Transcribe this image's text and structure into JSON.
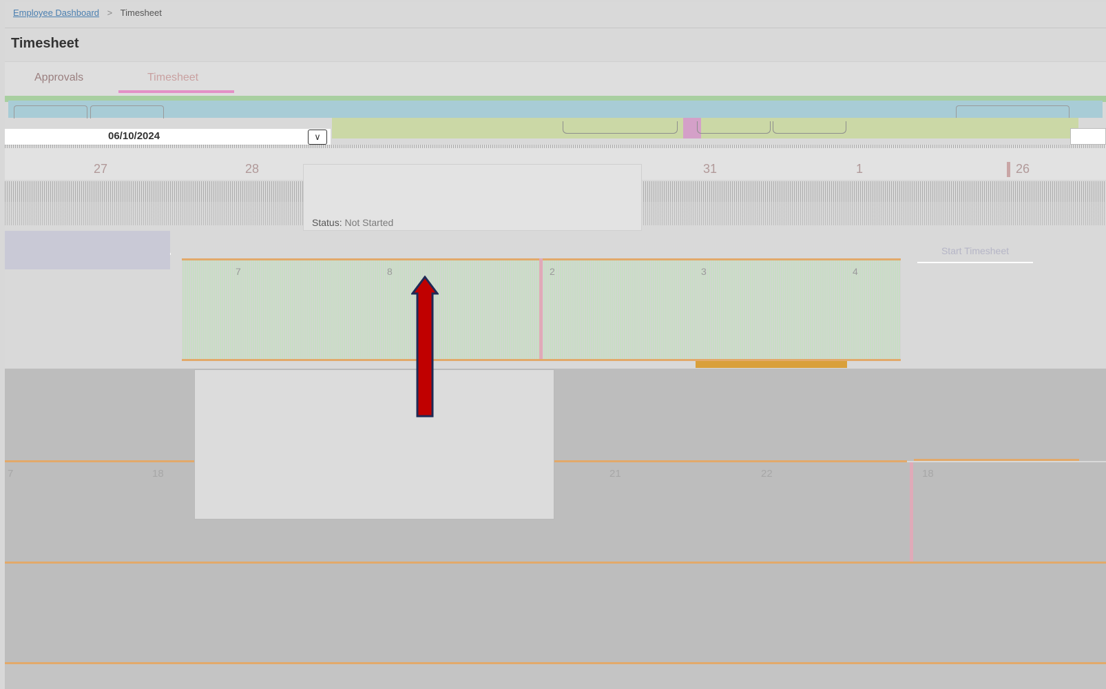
{
  "breadcrumb": {
    "root": "Employee Dashboard",
    "sep": ">",
    "current": "Timesheet"
  },
  "page_title": "Timesheet",
  "tabs": [
    {
      "label": "Approvals"
    },
    {
      "label": "Timesheet"
    }
  ],
  "date_picker": {
    "value": "06/10/2024",
    "toggle_icon": "chevron-down-icon"
  },
  "popover": {
    "status_label": "Status:",
    "status_value": "Not Started"
  },
  "start_button": {
    "label": "Start Timesheet"
  },
  "calendar": {
    "row1": [
      "27",
      "28",
      "31",
      "1",
      "26"
    ],
    "row2": [
      "7",
      "8",
      "2",
      "3",
      "4"
    ],
    "row4": [
      "7",
      "18",
      "21",
      "22",
      "18"
    ]
  },
  "colors": {
    "accent_tab": "#e390c6",
    "week_line": "#e2a96a",
    "arrow": "#c00000"
  }
}
